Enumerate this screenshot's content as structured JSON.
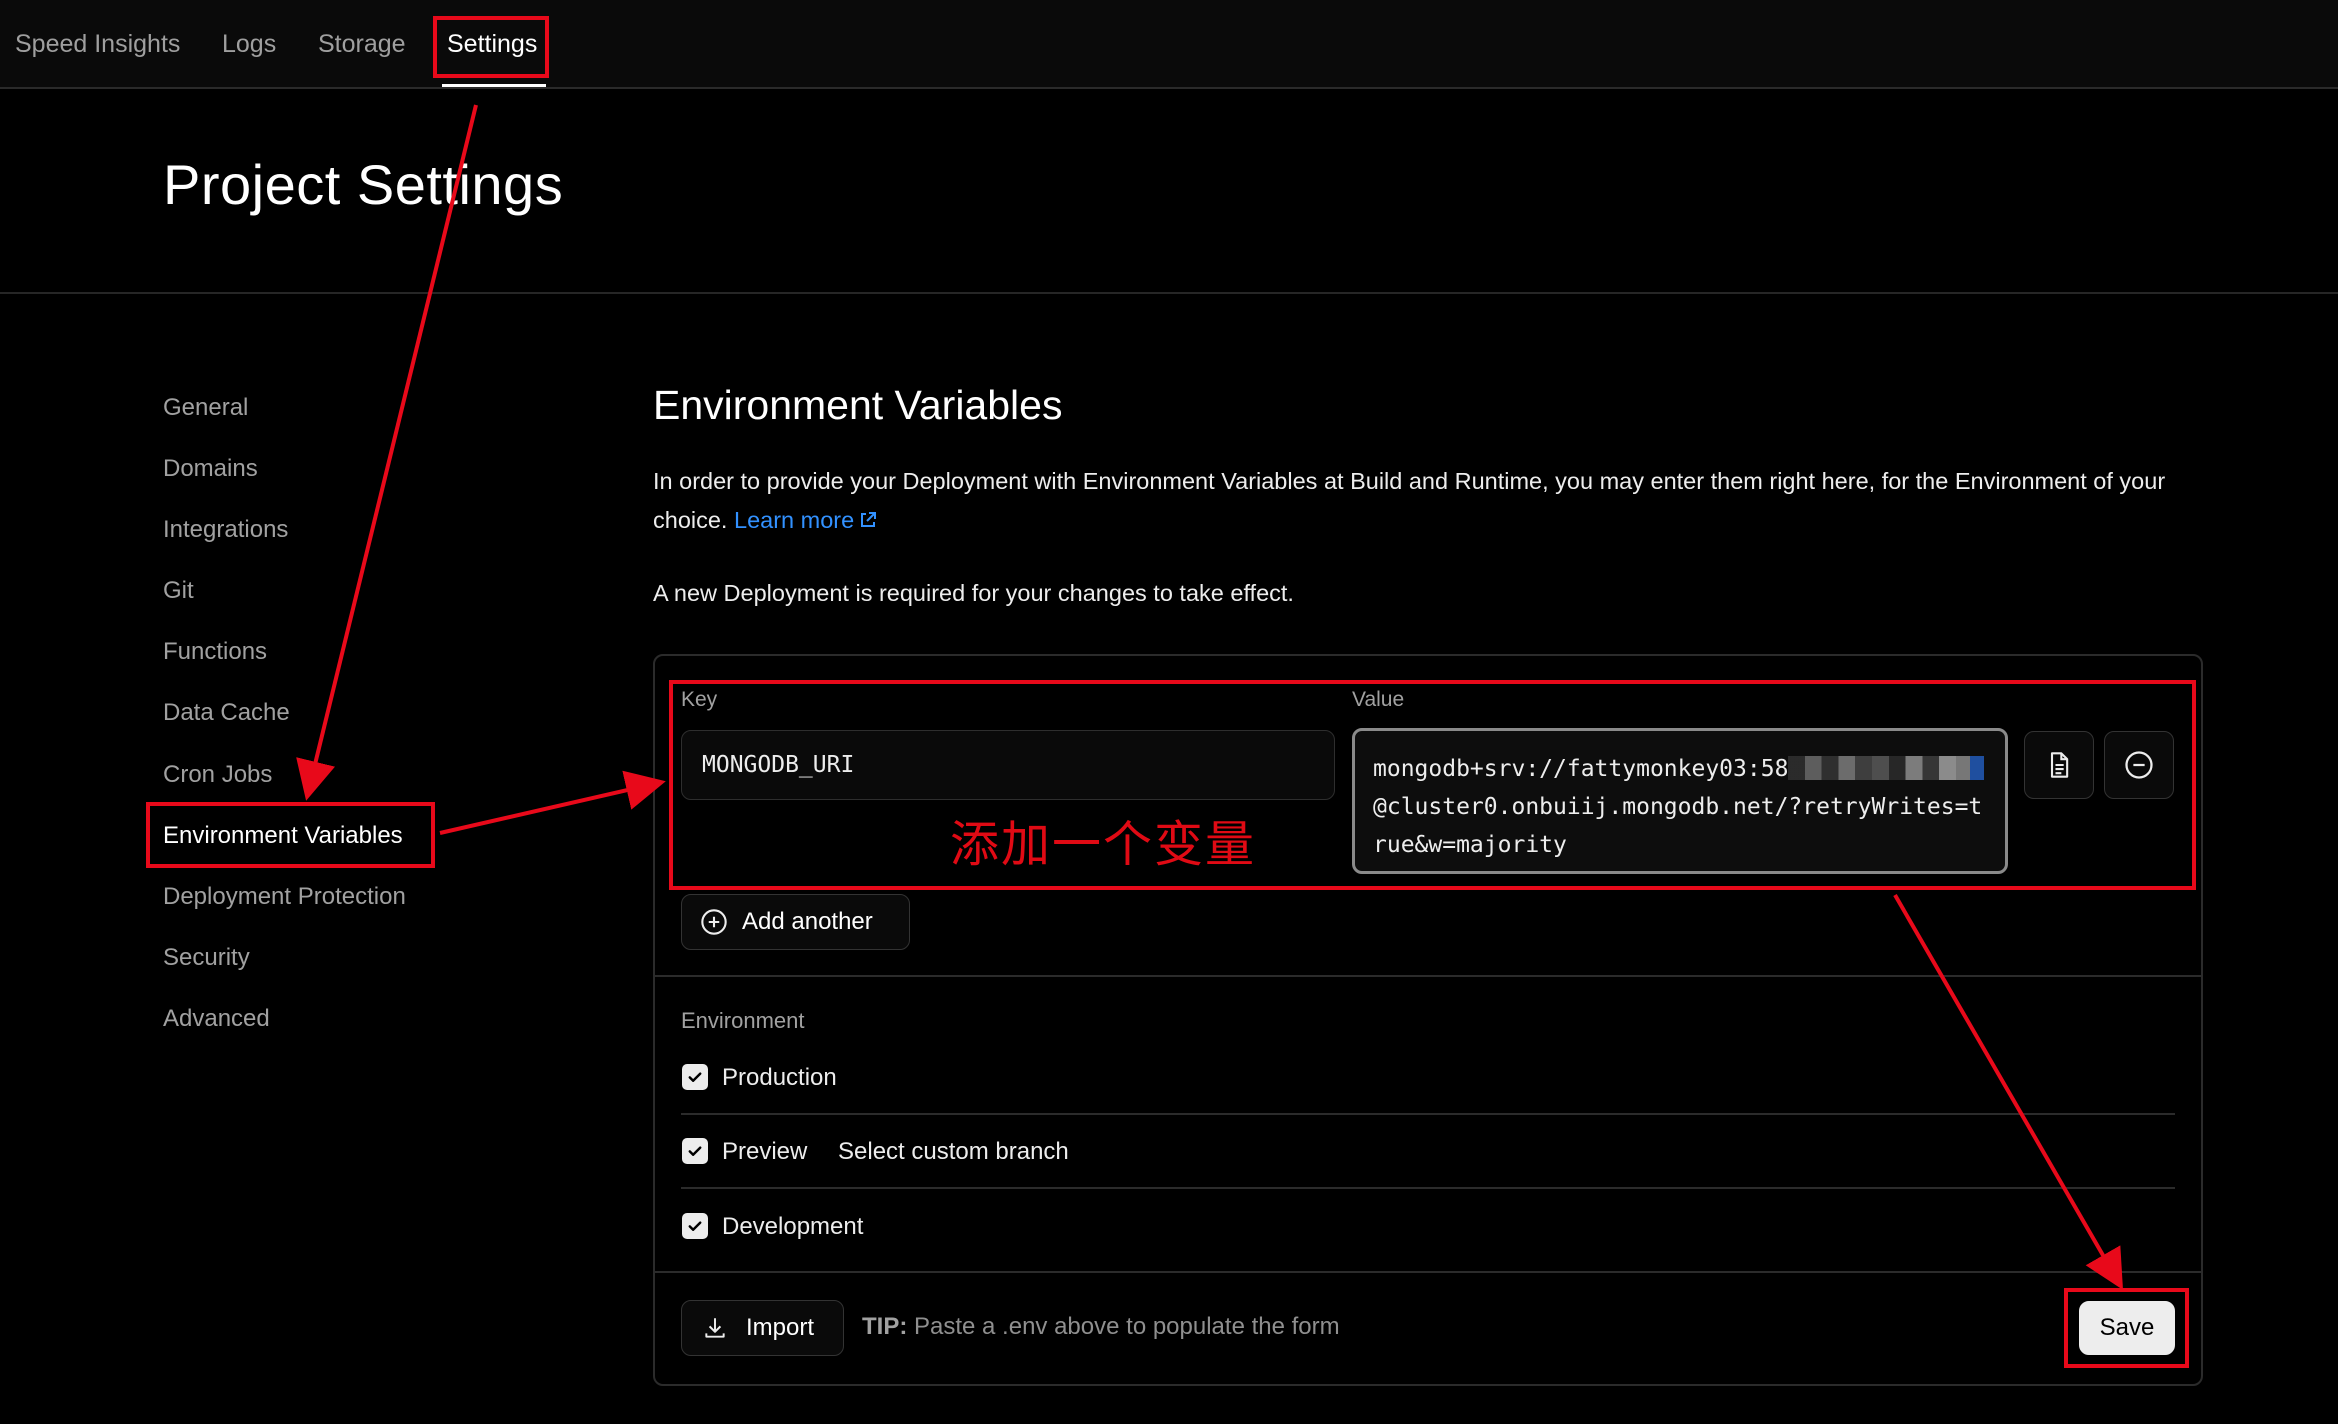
{
  "nav": {
    "items": [
      "Speed Insights",
      "Logs",
      "Storage",
      "Settings"
    ],
    "active": "Settings"
  },
  "page": {
    "title": "Project Settings"
  },
  "sidebar": {
    "items": [
      "General",
      "Domains",
      "Integrations",
      "Git",
      "Functions",
      "Data Cache",
      "Cron Jobs",
      "Environment Variables",
      "Deployment Protection",
      "Security",
      "Advanced"
    ],
    "active": "Environment Variables"
  },
  "main": {
    "title": "Environment Variables",
    "description": "In order to provide your Deployment with Environment Variables at Build and Runtime, you may enter them right here, for the Environment of your choice.",
    "learn_more": "Learn more",
    "notice": "A new Deployment is required for your changes to take effect."
  },
  "form": {
    "key_label": "Key",
    "value_label": "Value",
    "key_value": "MONGODB_URI",
    "value_prefix": "mongodb+srv://fattymonkey03:58",
    "value_suffix": "@cluster0.onbuiij.mongodb.net/?retryWrites=true&w=majority",
    "add_another": "Add another",
    "environment_label": "Environment",
    "environments": [
      "Production",
      "Preview",
      "Development"
    ],
    "select_branch": "Select custom branch",
    "import_label": "Import",
    "tip_bold": "TIP:",
    "tip_text": "Paste a .env above to populate the form",
    "save_label": "Save"
  },
  "annotation": {
    "text": "添加一个变量",
    "color": "#e00a14"
  },
  "colors": {
    "link": "#3291ff",
    "annotation": "#e8091a",
    "background": "#000000"
  }
}
